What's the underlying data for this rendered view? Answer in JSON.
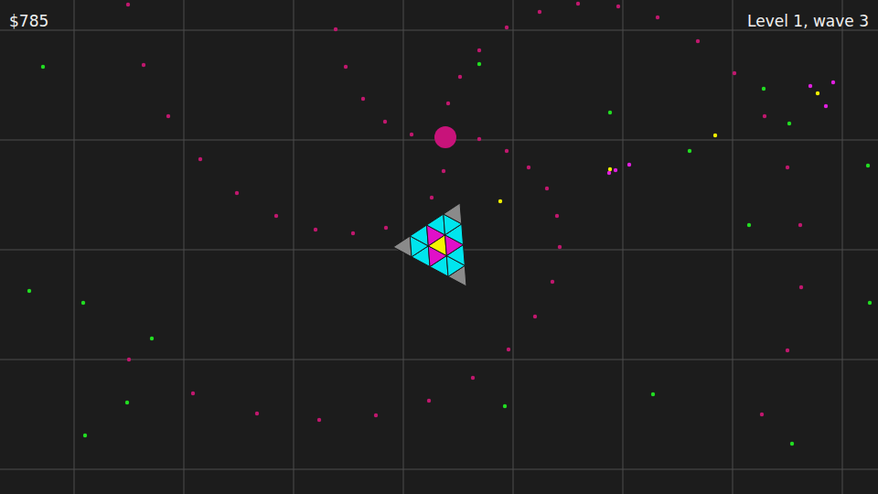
{
  "hud": {
    "money": "$785",
    "level": "Level 1, wave 3"
  },
  "ship": {
    "cells": [
      {
        "color": "#8a8a8a"
      },
      {
        "color": "#00e5ee"
      },
      {
        "color": "#00e5ee"
      },
      {
        "color": "#00e5ee"
      },
      {
        "color": "#00e5ee"
      },
      {
        "color": "#e010c8"
      },
      {
        "color": "#f5f500"
      },
      {
        "color": "#e010c8"
      },
      {
        "color": "#00e5ee"
      },
      {
        "color": "#8a8a8a"
      },
      {
        "color": "#00e5ee"
      },
      {
        "color": "#00e5ee"
      },
      {
        "color": "#e010c8"
      },
      {
        "color": "#00e5ee"
      },
      {
        "color": "#00e5ee"
      },
      {
        "color": "#8a8a8a"
      }
    ]
  },
  "enemies": [
    {
      "color": "#c8137a"
    }
  ],
  "particles": [
    {
      "color": "#c0186e"
    },
    {
      "color": "#22dd22"
    },
    {
      "color": "#f0f000"
    },
    {
      "color": "#e020e0"
    }
  ]
}
